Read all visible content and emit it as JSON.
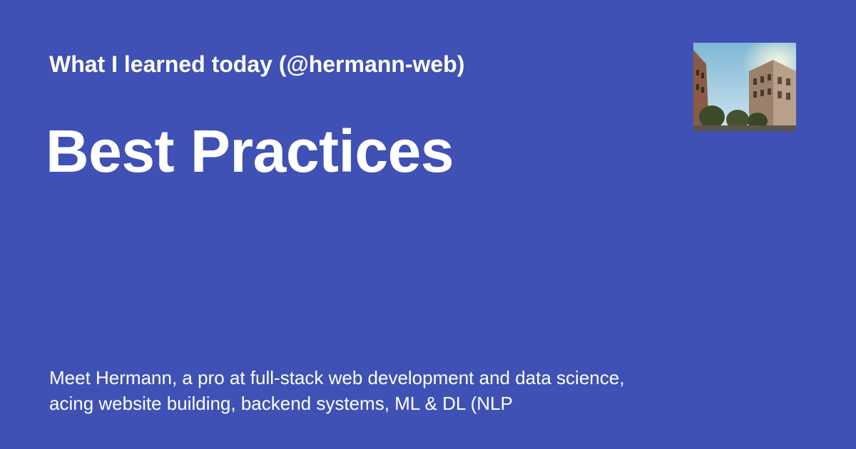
{
  "card": {
    "background_color": "#3F51B5",
    "text_color": "#FFFFFF",
    "site_title": "What I learned today (@hermann-web)",
    "page_title": "Best Practices",
    "description": "Meet Hermann, a pro at full-stack web development and data science, acing website building, backend systems, ML & DL (NLP"
  },
  "thumbnail": {
    "alt": "street-buildings-photo"
  }
}
